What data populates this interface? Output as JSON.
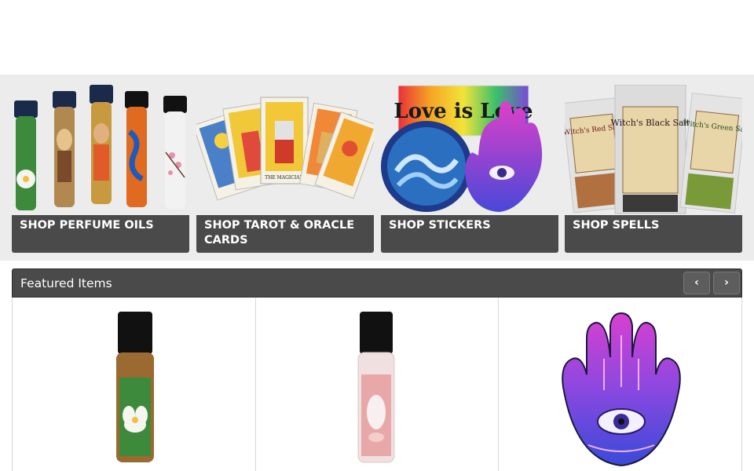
{
  "categories": [
    {
      "label": "SHOP PERFUME OILS"
    },
    {
      "label": "SHOP TAROT & ORACLE CARDS"
    },
    {
      "label": "SHOP STICKERS"
    },
    {
      "label": "SHOP SPELLS"
    }
  ],
  "sticker_text": "Love is Love",
  "spell_labels": [
    "Witch's Red Salt",
    "Witch's Black Salt",
    "Witch's Green Salt"
  ],
  "tarot_card_label": "THE MAGICIAN",
  "featured": {
    "title": "Featured Items",
    "prev_icon": "‹",
    "next_icon": "›"
  },
  "colors": {
    "band_bg": "#ececec",
    "label_bg": "#4a4a4a",
    "header_bg": "#4a4a4a"
  }
}
